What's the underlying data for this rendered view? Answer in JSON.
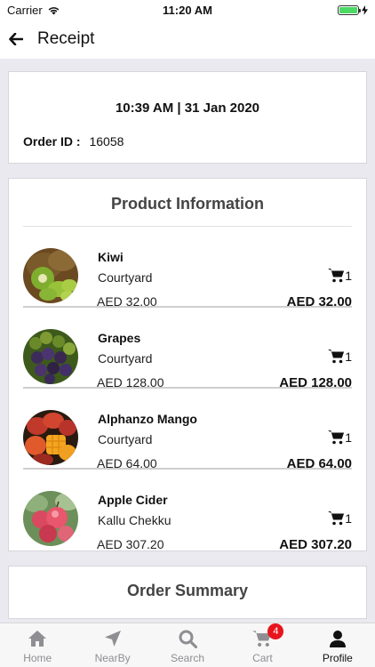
{
  "status_bar": {
    "carrier": "Carrier",
    "time": "11:20 AM"
  },
  "header": {
    "title": "Receipt"
  },
  "receipt": {
    "datetime": "10:39 AM | 31 Jan 2020",
    "order_id_label": "Order ID :",
    "order_id": "16058"
  },
  "products": {
    "title": "Product Information",
    "items": [
      {
        "name": "Kiwi",
        "vendor": "Courtyard",
        "price": "AED 32.00",
        "qty": "1",
        "total": "AED 32.00"
      },
      {
        "name": "Grapes",
        "vendor": "Courtyard",
        "price": "AED 128.00",
        "qty": "1",
        "total": "AED 128.00"
      },
      {
        "name": "Alphanzo Mango",
        "vendor": "Courtyard",
        "price": "AED 64.00",
        "qty": "1",
        "total": "AED 64.00"
      },
      {
        "name": "Apple Cider",
        "vendor": "Kallu Chekku",
        "price": "AED 307.20",
        "qty": "1",
        "total": "AED 307.20"
      }
    ]
  },
  "summary": {
    "title": "Order Summary"
  },
  "tabs": [
    {
      "label": "Home",
      "icon": "home-icon"
    },
    {
      "label": "NearBy",
      "icon": "navigation-arrow-icon"
    },
    {
      "label": "Search",
      "icon": "search-icon"
    },
    {
      "label": "Cart",
      "icon": "cart-icon",
      "badge": "4"
    },
    {
      "label": "Profile",
      "icon": "person-icon",
      "active": true
    }
  ],
  "colors": {
    "badge": "#e8141c",
    "battery": "#4cd964",
    "background": "#e9e9ef"
  }
}
